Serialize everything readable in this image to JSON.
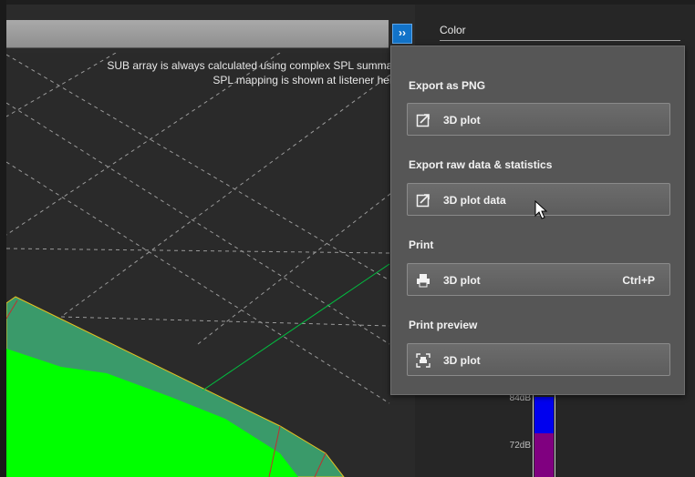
{
  "plot": {
    "note_line1": "SUB array is always calculated using complex SPL summatio",
    "note_line2": "SPL mapping is shown at listener heigh"
  },
  "toolbar": {
    "expand_label": "››"
  },
  "side_panel": {
    "color_label": "Color",
    "legend_ticks": [
      "84dB",
      "72dB"
    ],
    "legend_colors": [
      "#0000ee",
      "#800080"
    ]
  },
  "export_menu": {
    "sections": [
      {
        "title": "Export as PNG",
        "button_label": "3D plot",
        "icon": "export-icon",
        "shortcut": ""
      },
      {
        "title": "Export raw data & statistics",
        "button_label": "3D plot data",
        "icon": "export-icon",
        "shortcut": ""
      },
      {
        "title": "Print",
        "button_label": "3D plot",
        "icon": "printer-icon",
        "shortcut": "Ctrl+P"
      },
      {
        "title": "Print preview",
        "button_label": "3D plot",
        "icon": "print-preview-icon",
        "shortcut": ""
      }
    ]
  },
  "colors": {
    "accent": "#1273c9",
    "spl_green": "#00ff00",
    "spl_dark_green": "#3a9a6a",
    "axis_green": "#00c040",
    "edge_yellow": "#e6c020",
    "edge_red": "#c03030"
  }
}
